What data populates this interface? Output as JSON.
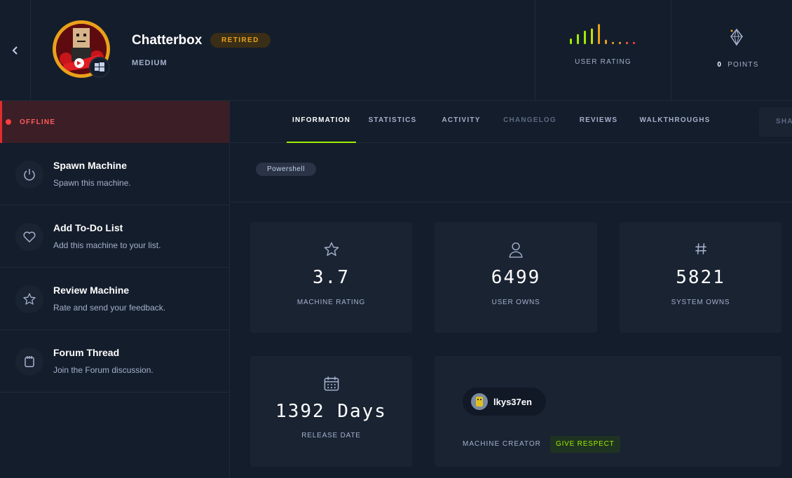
{
  "machine": {
    "name": "Chatterbox",
    "status_badge": "RETIRED",
    "difficulty": "MEDIUM",
    "os_icon": "windows-icon"
  },
  "header": {
    "rating_label": "USER RATING",
    "rating_bar_levels": [
      0.25,
      0.45,
      0.6,
      0.7,
      0.9,
      0.2,
      0.1,
      0.1,
      0.1,
      0.1
    ],
    "points_value": "0",
    "points_label": "POINTS"
  },
  "sidebar": {
    "status": "OFFLINE",
    "items": [
      {
        "title": "Spawn Machine",
        "subtitle": "Spawn this machine.",
        "icon": "power-icon"
      },
      {
        "title": "Add To-Do List",
        "subtitle": "Add this machine to your list.",
        "icon": "heart-icon"
      },
      {
        "title": "Review Machine",
        "subtitle": "Rate and send your feedback.",
        "icon": "star-icon"
      },
      {
        "title": "Forum Thread",
        "subtitle": "Join the Forum discussion.",
        "icon": "notepad-icon"
      }
    ]
  },
  "tabs": [
    {
      "label": "INFORMATION",
      "state": "active"
    },
    {
      "label": "STATISTICS",
      "state": "normal"
    },
    {
      "label": "ACTIVITY",
      "state": "normal"
    },
    {
      "label": "CHANGELOG",
      "state": "muted"
    },
    {
      "label": "REVIEWS",
      "state": "normal"
    },
    {
      "label": "WALKTHROUGHS",
      "state": "normal"
    }
  ],
  "share_label": "SHA",
  "tags": [
    "Powershell"
  ],
  "stats": {
    "rating": {
      "value": "3.7",
      "label": "MACHINE RATING"
    },
    "user_owns": {
      "value": "6499",
      "label": "USER OWNS"
    },
    "system_owns": {
      "value": "5821",
      "label": "SYSTEM OWNS"
    },
    "release": {
      "value": "1392 Days",
      "label": "RELEASE DATE"
    }
  },
  "creator": {
    "name": "lkys37en",
    "label": "MACHINE CREATOR",
    "respect_label": "GIVE RESPECT"
  },
  "colors": {
    "accent_green": "#9fef00",
    "retired_orange": "#e9a11b",
    "offline_red": "#ff3e3e",
    "background": "#141d2b",
    "card": "#1a2332"
  }
}
